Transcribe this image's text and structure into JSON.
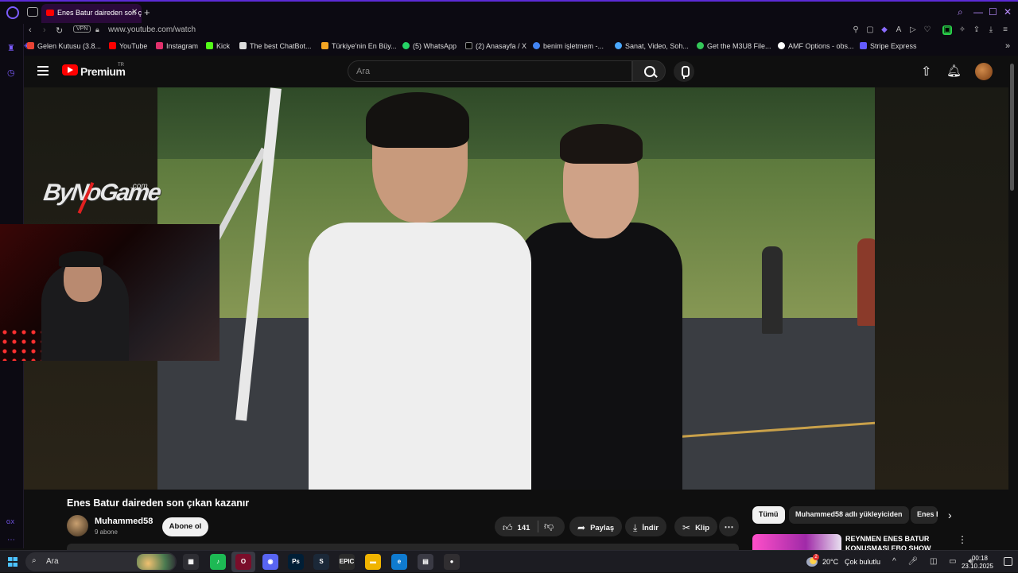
{
  "browser": {
    "active_tab_title": "Enes Batur daireden son ç",
    "url": "www.youtube.com/watch",
    "vpn_label": "VPN",
    "bookmarks": [
      {
        "label": "Gelen Kutusu (3.8...",
        "color": "#ea4335"
      },
      {
        "label": "YouTube",
        "color": "#ff0000"
      },
      {
        "label": "Instagram",
        "color": "#e1306c"
      },
      {
        "label": "Kick",
        "color": "#53fc18"
      },
      {
        "label": "The best ChatBot...",
        "color": "#dddddd"
      },
      {
        "label": "Türkiye'nin En Büy...",
        "color": "#f5a623"
      },
      {
        "label": "(5) WhatsApp",
        "color": "#25d366"
      },
      {
        "label": "(2) Anasayfa / X",
        "color": "#000000"
      },
      {
        "label": "benim işletmem -...",
        "color": "#4285f4"
      },
      {
        "label": "Sanat, Video, Soh...",
        "color": "#4aa8ff"
      },
      {
        "label": "Get the M3U8 File...",
        "color": "#34c759"
      },
      {
        "label": "AMF Options - obs...",
        "color": "#ffffff"
      },
      {
        "label": "Stripe Express",
        "color": "#635bff"
      }
    ]
  },
  "youtube": {
    "brand": "Premium",
    "country": "TR",
    "search_placeholder": "Ara"
  },
  "overlay": {
    "brand_text": "ByNoGame",
    "brand_suffix": ".com"
  },
  "video": {
    "title": "Enes Batur daireden son çıkan kazanır",
    "channel_name": "Muhammed58",
    "subscribers": "9 abone",
    "subscribe_label": "Abone ol",
    "likes": "141",
    "share_label": "Paylaş",
    "download_label": "İndir",
    "clip_label": "Klip"
  },
  "recommendations": {
    "chips": [
      "Tümü",
      "Muhammed58 adlı yükleyiciden",
      "Enes B"
    ],
    "first_title": "REYNMEN ENES BATUR KONUŞMASI EBO SHOW"
  },
  "taskbar": {
    "search_placeholder": "Ara",
    "weather_temp": "20°C",
    "weather_desc": "Çok bulutlu",
    "weather_badge": "2",
    "time": "00:18",
    "date": "23.10.2025",
    "apps": [
      {
        "name": "task-view",
        "label": "▦",
        "color": "#2d2d33"
      },
      {
        "name": "spotify",
        "label": "♪",
        "color": "#1db954"
      },
      {
        "name": "opera-gx",
        "label": "O",
        "color": "#7a0d2a"
      },
      {
        "name": "discord-app",
        "label": "◉",
        "color": "#5865f2"
      },
      {
        "name": "photoshop",
        "label": "Ps",
        "color": "#001e36"
      },
      {
        "name": "steam",
        "label": "S",
        "color": "#1b2838"
      },
      {
        "name": "epic-games",
        "label": "EPIC",
        "color": "#2a2a2a"
      },
      {
        "name": "file-explorer",
        "label": "▬",
        "color": "#f0b400"
      },
      {
        "name": "edge",
        "label": "e",
        "color": "#0f7bd0"
      },
      {
        "name": "ms-store",
        "label": "▤",
        "color": "#3a3a44"
      },
      {
        "name": "obs",
        "label": "●",
        "color": "#302e31"
      }
    ]
  }
}
